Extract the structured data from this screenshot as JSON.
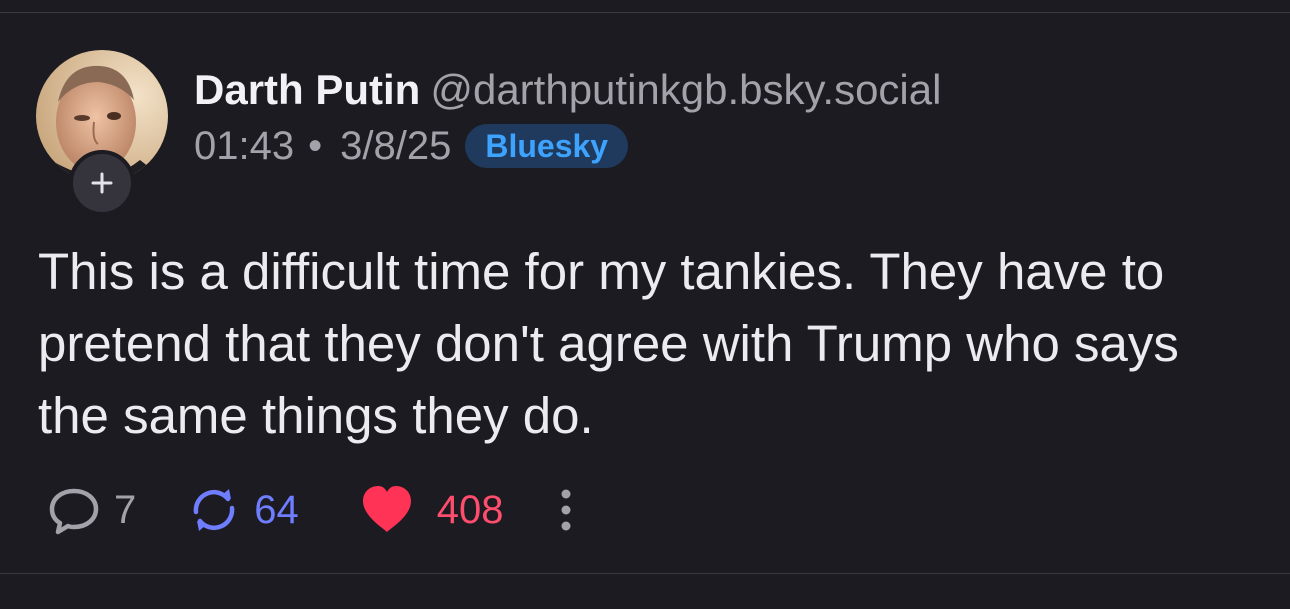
{
  "post": {
    "author": {
      "display_name": "Darth Putin",
      "handle": "@darthputinkgb.bsky.social"
    },
    "time": "01:43",
    "separator": "•",
    "date": "3/8/25",
    "source_badge": "Bluesky",
    "text": "This is a difficult time for my tankies. They have to pretend that they don't agree with Trump who says the same things they do.",
    "stats": {
      "replies": "7",
      "reposts": "64",
      "likes": "408"
    }
  },
  "colors": {
    "background": "#1c1b21",
    "badge_text": "#3ea3ff",
    "repost": "#6f7dff",
    "like": "#ff4d6d",
    "muted": "#a3a2aa"
  },
  "icons": {
    "follow": "plus-icon",
    "reply": "speech-bubble-icon",
    "repost": "repost-arrows-icon",
    "like": "heart-icon",
    "more": "vertical-ellipsis-icon"
  }
}
